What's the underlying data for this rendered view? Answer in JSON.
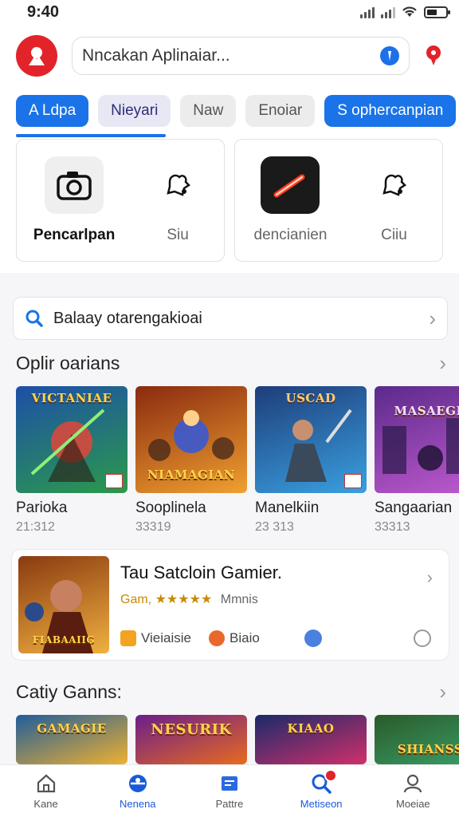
{
  "status_bar": {
    "time": "9:40"
  },
  "header": {
    "search_placeholder": "Nncakan Aplinaiar..."
  },
  "tabs": [
    {
      "label": "A Ldpa"
    },
    {
      "label": "Nieyari"
    },
    {
      "label": "Naw"
    },
    {
      "label": "Enoiar"
    },
    {
      "label": "S ophercanpian"
    }
  ],
  "top_cards": {
    "left": {
      "cell1_label": "Pencarlpan",
      "cell2_label": "Siu"
    },
    "right": {
      "cell1_label": "dencianien",
      "cell2_label": "Ciiu"
    }
  },
  "suggestion": {
    "text": "Balaay otarengakioai"
  },
  "section1": {
    "title": "Oplir oarians",
    "games": [
      {
        "name": "Parioka",
        "size": "21:312",
        "art_title": "VICTANIAE",
        "colors": [
          "#1d4fa8",
          "#2b9a4a"
        ]
      },
      {
        "name": "Sooplinela",
        "size": "33319",
        "art_title": "NIAMAGIAN",
        "colors": [
          "#8a2a10",
          "#f0a030"
        ]
      },
      {
        "name": "Manelkiin",
        "size": "23 313",
        "art_title": "USCAD",
        "colors": [
          "#1e3d7a",
          "#3aa0e0"
        ]
      },
      {
        "name": "Sangaarian",
        "size": "33313",
        "art_title": "MASAEGR",
        "colors": [
          "#5b2a8a",
          "#c05ad0"
        ]
      }
    ]
  },
  "feature": {
    "title": "Tau Satcloin Gamier.",
    "rating_prefix": "Gam,",
    "stars": "★★★★★",
    "rating_sub": "Mmnis",
    "chip1": "Vieiaisie",
    "chip2": "Biaio",
    "art_title": "FIABAAIIG"
  },
  "section2": {
    "title": "Catiy Ganns:",
    "games": [
      {
        "art_title": "GAMAGIE",
        "colors": [
          "#205d9a",
          "#f0b030"
        ]
      },
      {
        "art_title": "NESURIK",
        "colors": [
          "#6a1e8a",
          "#e86a20"
        ]
      },
      {
        "art_title": "KIAAO",
        "colors": [
          "#1a2a6a",
          "#d0306a"
        ]
      },
      {
        "art_title": "SHIANSS",
        "colors": [
          "#2a5a2a",
          "#3aa06a"
        ]
      }
    ]
  },
  "bottom_nav": [
    {
      "label": "Kane"
    },
    {
      "label": "Nenena"
    },
    {
      "label": "Pattre"
    },
    {
      "label": "Metiseon"
    },
    {
      "label": "Moeiae"
    }
  ],
  "colors": {
    "accent": "#1a73e8",
    "brand_red": "#e2232a"
  }
}
